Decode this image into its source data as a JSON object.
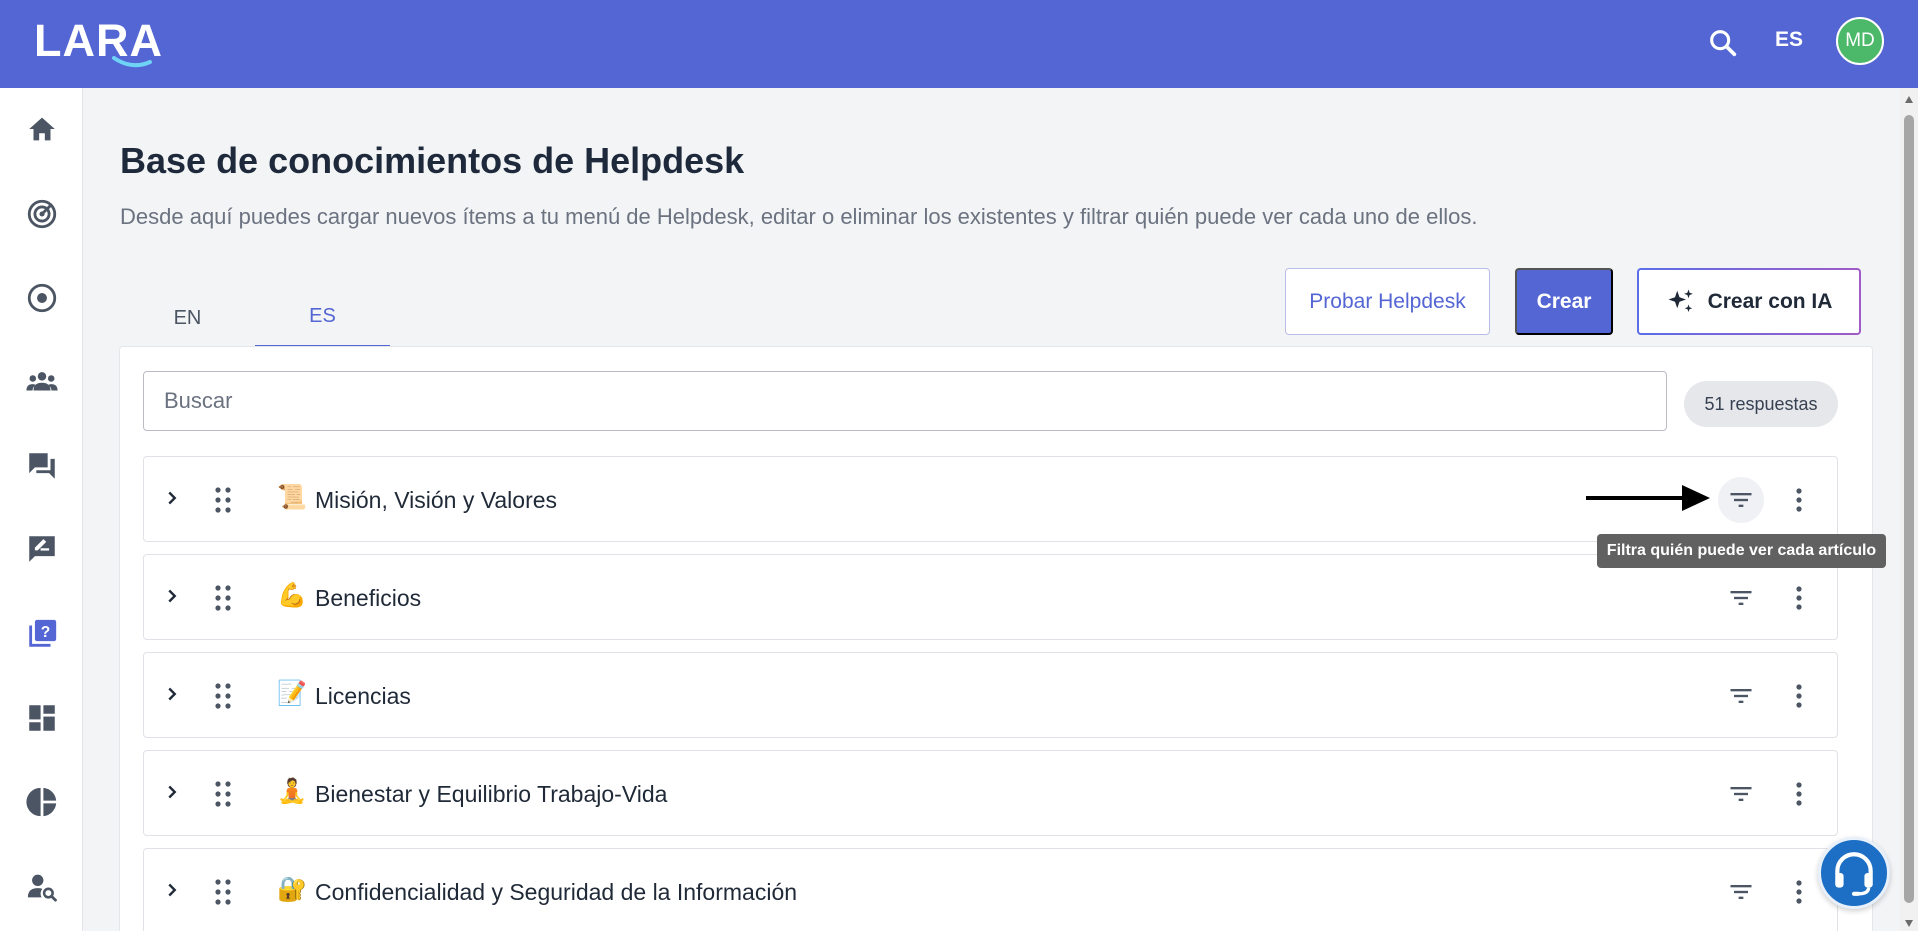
{
  "header": {
    "logo_text": "LARA",
    "language": "ES",
    "avatar_initials": "MD",
    "brand_color": "#5465d4"
  },
  "sidebar": {
    "items": [
      {
        "icon": "home-icon",
        "active": false
      },
      {
        "icon": "radar-icon",
        "active": false
      },
      {
        "icon": "target-icon",
        "active": false
      },
      {
        "icon": "people-icon",
        "active": false
      },
      {
        "icon": "chat-icon",
        "active": false
      },
      {
        "icon": "feedback-edit-icon",
        "active": false
      },
      {
        "icon": "help-book-icon",
        "active": true
      },
      {
        "icon": "dashboard-icon",
        "active": false
      },
      {
        "icon": "pie-chart-icon",
        "active": false
      },
      {
        "icon": "person-search-icon",
        "active": false
      }
    ]
  },
  "main": {
    "title": "Base de conocimientos de Helpdesk",
    "description": "Desde aquí puedes cargar nuevos ítems a tu menú de Helpdesk, editar o eliminar los existentes y filtrar quién puede ver cada uno de ellos.",
    "tabs": [
      {
        "label": "EN",
        "active": false
      },
      {
        "label": "ES",
        "active": true
      }
    ],
    "buttons": {
      "try_label": "Probar Helpdesk",
      "create_label": "Crear",
      "create_ai_label": "Crear con IA"
    },
    "search": {
      "placeholder": "Buscar",
      "value": ""
    },
    "count_label": "51 respuestas",
    "tooltip": "Filtra quién puede ver cada artículo",
    "rows": [
      {
        "emoji": "📜",
        "title": "Misión, Visión y Valores"
      },
      {
        "emoji": "💪",
        "title": "Beneficios"
      },
      {
        "emoji": "📝",
        "title": "Licencias"
      },
      {
        "emoji": "🧘",
        "title": "Bienestar y Equilibrio Trabajo-Vida"
      },
      {
        "emoji": "🔐",
        "title": "Confidencialidad y Seguridad de la Información"
      }
    ]
  }
}
